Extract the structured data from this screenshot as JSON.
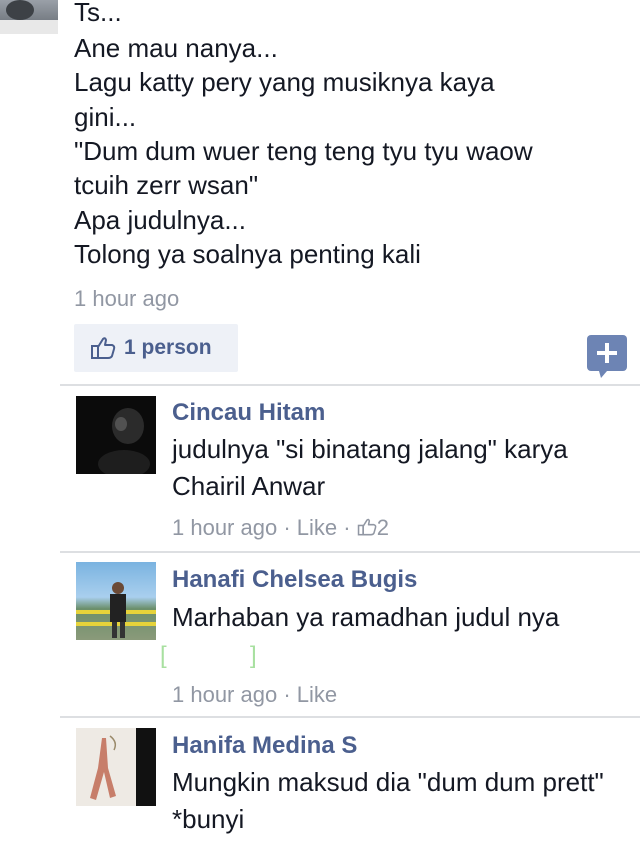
{
  "post": {
    "lines": [
      "Ts...",
      "Ane mau nanya...",
      "Lagu katty pery yang musiknya kaya",
      "gini...",
      "\"Dum dum wuer teng teng tyu tyu waow",
      "tcuih zerr wsan\"",
      "Apa judulnya...",
      "Tolong ya soalnya penting kali"
    ],
    "time": "1 hour ago",
    "likes_label": "1 person"
  },
  "comments": [
    {
      "name": "Cincau Hitam",
      "lines": [
        "judulnya \"si binatang jalang\" karya",
        "Chairil Anwar"
      ],
      "time": "1 hour ago",
      "sep": "·",
      "like": "Like",
      "like_count": "2"
    },
    {
      "name": "Hanafi Chelsea Bugis",
      "lines": [
        "Marhaban ya ramadhan judul nya"
      ],
      "time": "1 hour ago",
      "sep": "·",
      "like": "Like"
    },
    {
      "name": "Hanifa Medina S",
      "lines": [
        "Mungkin maksud dia \"dum dum prett\"",
        "*bunyi"
      ]
    }
  ],
  "icons": {
    "like": "thumbs-up-icon",
    "add": "plus-icon"
  },
  "colors": {
    "name_link": "#4b5f8e",
    "meta_gray": "#9197a3",
    "like_box_bg": "#eef1f7",
    "plus_button": "#6d84b4"
  }
}
